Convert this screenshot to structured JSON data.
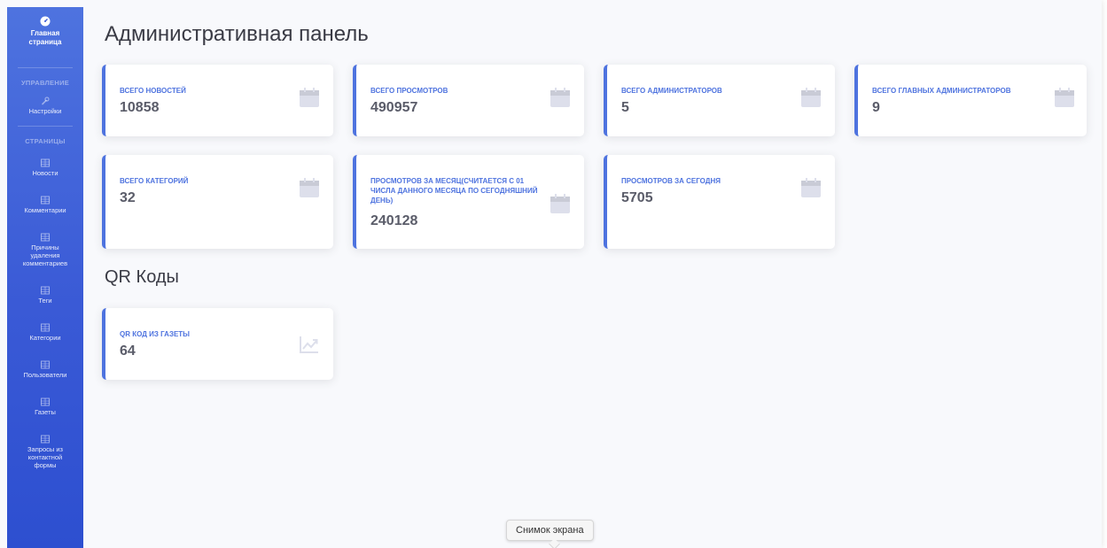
{
  "sidebar": {
    "home_label_1": "Главная",
    "home_label_2": "страница",
    "heading_manage": "УПРАВЛЕНИЕ",
    "settings_label": "Настройки",
    "heading_pages": "СТРАНИЦЫ",
    "items": [
      {
        "label": "Новости",
        "icon": "table-icon"
      },
      {
        "label": "Комментарии",
        "icon": "table-icon"
      },
      {
        "label_lines": [
          "Причины",
          "удаления",
          "комментариев"
        ],
        "icon": "table-icon"
      },
      {
        "label": "Теги",
        "icon": "table-icon"
      },
      {
        "label": "Категории",
        "icon": "table-icon"
      },
      {
        "label": "Пользователи",
        "icon": "table-icon"
      },
      {
        "label": "Газеты",
        "icon": "table-icon"
      },
      {
        "label_lines": [
          "Запросы из",
          "контактной",
          "формы"
        ],
        "icon": "table-icon"
      }
    ]
  },
  "main": {
    "title": "Административная панель",
    "stats": [
      {
        "label": "ВСЕГО НОВОСТЕЙ",
        "value": "10858",
        "icon": "calendar-icon"
      },
      {
        "label": "ВСЕГО ПРОСМОТРОВ",
        "value": "490957",
        "icon": "calendar-icon"
      },
      {
        "label": "ВСЕГО АДМИНИСТРАТОРОВ",
        "value": "5",
        "icon": "calendar-icon"
      },
      {
        "label": "ВСЕГО ГЛАВНЫХ АДМИНИСТРАТОРОВ",
        "value": "9",
        "icon": "calendar-icon"
      },
      {
        "label": "ВСЕГО КАТЕГОРИЙ",
        "value": "32",
        "icon": "calendar-icon"
      },
      {
        "label": "ПРОСМОТРОВ ЗА МЕСЯЦ(СЧИТАЕТСЯ С 01 ЧИСЛА ДАННОГО МЕСЯЦА ПО СЕГОДНЯШНИЙ ДЕНЬ)",
        "value": "240128",
        "icon": "calendar-icon"
      },
      {
        "label": "ПРОСМОТРОВ ЗА СЕГОДНЯ",
        "value": "5705",
        "icon": "calendar-icon"
      }
    ],
    "qr_title": "QR Коды",
    "qr": {
      "label": "QR КОД ИЗ ГАЗЕТЫ",
      "value": "64",
      "icon": "chart-line-icon"
    }
  },
  "tooltip": "Снимок экрана",
  "colors": {
    "accent": "#4e73df",
    "sidebar_bottom": "#2d4fd0",
    "text": "#5a5c69",
    "icon_gray": "#dddfeb"
  }
}
